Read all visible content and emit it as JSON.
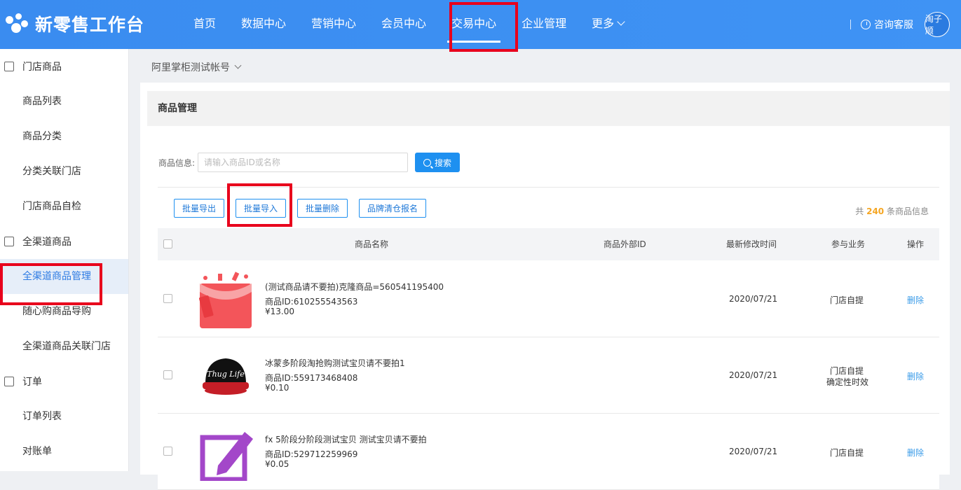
{
  "header": {
    "brand": "新零售工作台",
    "nav": [
      "首页",
      "数据中心",
      "营销中心",
      "会员中心",
      "交易中心",
      "企业管理",
      "更多"
    ],
    "active_nav": "交易中心",
    "consult": "咨询客服",
    "avatar": "淘子顺"
  },
  "sidebar": {
    "groups": [
      {
        "title": "门店商品",
        "items": [
          "商品列表",
          "商品分类",
          "分类关联门店",
          "门店商品自检"
        ]
      },
      {
        "title": "全渠道商品",
        "items": [
          "全渠道商品管理",
          "随心购商品导购",
          "全渠道商品关联门店"
        ]
      },
      {
        "title": "订单",
        "items": [
          "订单列表",
          "对账单"
        ]
      }
    ],
    "active_item": "全渠道商品管理"
  },
  "account": "阿里掌柜测试帐号",
  "panel": {
    "title": "商品管理",
    "search_label": "商品信息:",
    "search_placeholder": "请输入商品ID或名称",
    "search_button": "搜索",
    "actions": [
      "批量导出",
      "批量导入",
      "批量删除",
      "品牌清仓报名"
    ],
    "total_prefix": "共",
    "total_count": "240",
    "total_suffix": "条商品信息"
  },
  "table": {
    "columns": [
      "商品名称",
      "商品外部ID",
      "最新修改时间",
      "参与业务",
      "操作"
    ],
    "rows": [
      {
        "name": "(测试商品请不要拍)克隆商品=560541195400",
        "id": "商品ID:610255543563",
        "price": "¥13.00",
        "ext_id": "",
        "time": "2020/07/21",
        "biz": "门店自提",
        "biz2": "",
        "op": "删除",
        "thumb": "red-bag"
      },
      {
        "name": "冰蒙多阶段淘抢购测试宝贝请不要拍1",
        "id": "商品ID:559173468408",
        "price": "¥0.10",
        "ext_id": "",
        "time": "2020/07/21",
        "biz": "门店自提",
        "biz2": "确定性时效",
        "op": "删除",
        "thumb": "cap"
      },
      {
        "name": "fx 5阶段分阶段测试宝贝 测试宝贝请不要拍",
        "id": "商品ID:529712259969",
        "price": "¥0.05",
        "ext_id": "",
        "time": "2020/07/21",
        "biz": "门店自提",
        "biz2": "",
        "op": "删除",
        "thumb": "pencil"
      }
    ]
  },
  "thumb_text": "Thug Life",
  "colors": {
    "primary": "#3a8cf0",
    "highlight": "#e8001c",
    "link": "#3a9be8",
    "accent": "#f5a623"
  }
}
